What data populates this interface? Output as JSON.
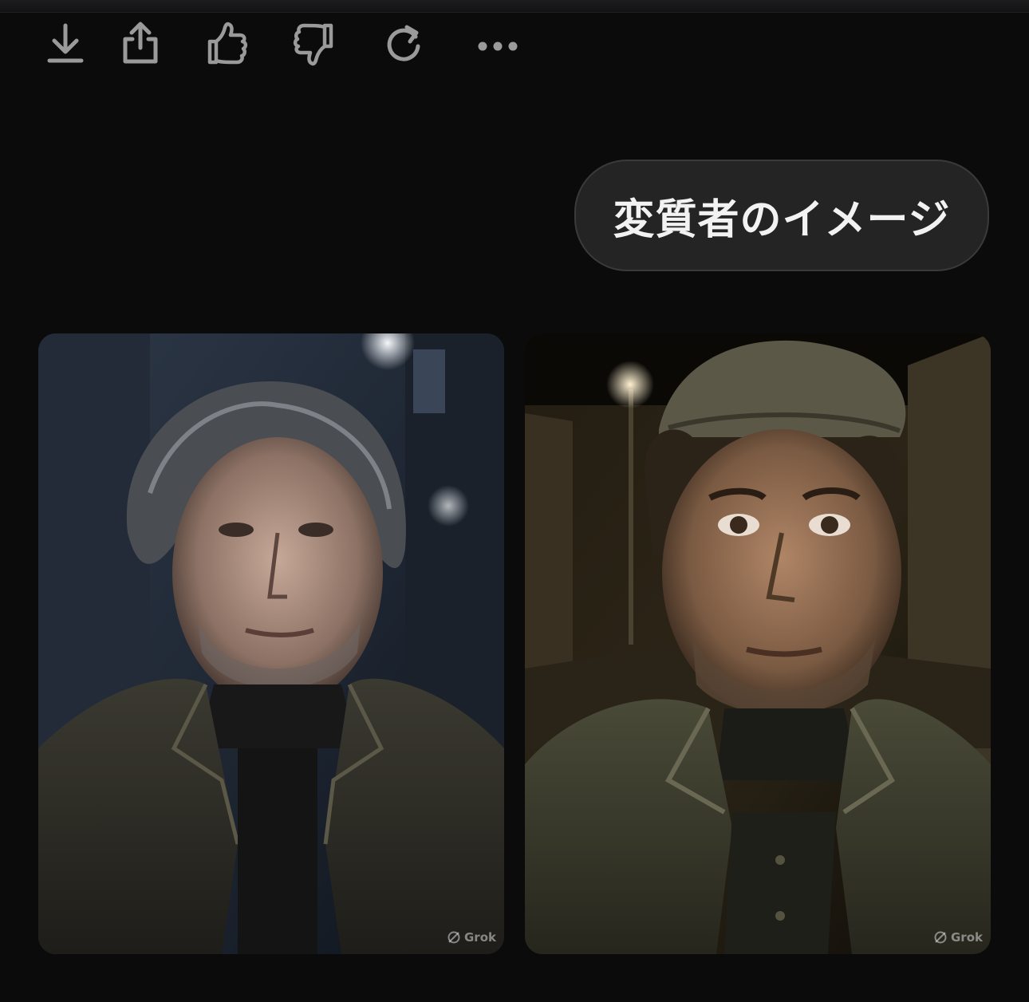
{
  "actions": {
    "download_icon": "download-icon",
    "share_icon": "share-icon",
    "like_icon": "thumbs-up-icon",
    "dislike_icon": "thumbs-down-icon",
    "regenerate_icon": "refresh-icon",
    "more_icon": "more-horizontal-icon"
  },
  "user_message": {
    "text": "変質者のイメージ"
  },
  "images": [
    {
      "watermark": "Grok"
    },
    {
      "watermark": "Grok"
    }
  ],
  "colors": {
    "background": "#0b0b0b",
    "bubble": "#242424",
    "icon": "#9a9a9a",
    "text": "#f2f2f2"
  }
}
